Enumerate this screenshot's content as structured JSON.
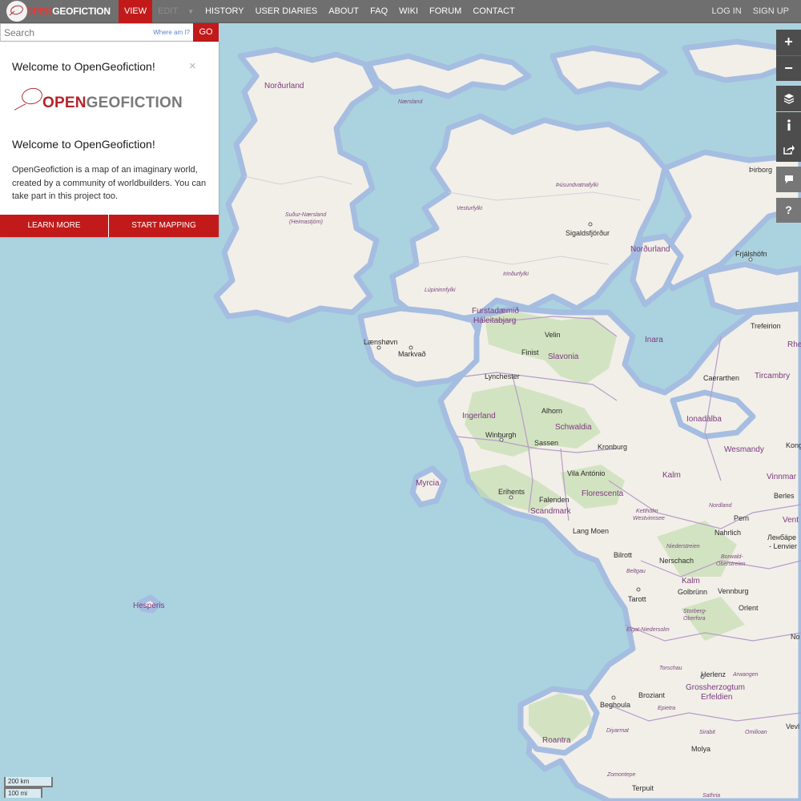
{
  "topbar": {
    "logo_part1": "OPEN",
    "logo_part2": "GEOFICTION",
    "nav": [
      {
        "label": "VIEW",
        "state": "active"
      },
      {
        "label": "EDIT",
        "state": "disabled"
      },
      {
        "label": "HISTORY"
      },
      {
        "label": "USER DIARIES"
      },
      {
        "label": "ABOUT"
      },
      {
        "label": "FAQ"
      },
      {
        "label": "WIKI"
      },
      {
        "label": "FORUM"
      },
      {
        "label": "CONTACT"
      }
    ],
    "login": "LOG IN",
    "signup": "SIGN UP"
  },
  "search": {
    "placeholder": "Search",
    "where_am_i": "Where am I?",
    "go": "GO"
  },
  "welcome": {
    "heading": "Welcome to OpenGeofiction!",
    "close_glyph": "×",
    "logo_a": "OPEN",
    "logo_b": "GEOFICTION",
    "heading2": "Welcome to OpenGeofiction!",
    "body": "OpenGeofiction is a map of an imaginary world, created by a community of worldbuilders. You can take part in this project too.",
    "learn_more": "LEARN MORE",
    "start_mapping": "START MAPPING"
  },
  "controls": {
    "zoom_in": "+",
    "zoom_out": "−",
    "layers_icon": "layers-icon",
    "info_icon": "info-icon",
    "share_icon": "share-icon",
    "note_icon": "note-icon",
    "query": "?"
  },
  "scale": {
    "km": "200 km",
    "mi": "100 mi"
  },
  "map_labels": {
    "nordurland_w": "Norðurland",
    "naersland": "Nærsland",
    "sudur": "Suður-Nærsland",
    "heimastjorn": "(Heimastjórn)",
    "thusund": "Þúsundvatnafylki",
    "vesturfylki": "Vesturfylki",
    "sigalds": "Sigaldsfjörður",
    "nordurland_e": "Norðurland",
    "thirborg": "Þirborg",
    "frjalshofn": "Frjálshöfn",
    "irindur": "Irinðurfylki",
    "lupinin": "Lúpininnfylki",
    "furstadaemid": "Furstadæmið",
    "haleitabjarg": "Háleitabjarg",
    "laenshovn": "Lænshøvn",
    "markvad": "Markvað",
    "velin": "Velin",
    "finist": "Finist",
    "slavonia": "Slavonia",
    "inara": "Inara",
    "trefeirion": "Trefeirion",
    "rhe": "Rhe",
    "lynchester": "Lynchester",
    "caerarthen": "Caerarthen",
    "tircambry": "Tircambry",
    "ingerland": "Ingerland",
    "alhorn": "Alhorn",
    "schwaldia": "Schwaldia",
    "ionadalba": "Ionadàlba",
    "winburgh": "Winburgh",
    "sassen": "Sassen",
    "kronburg": "Kronburg",
    "wesmandy": "Wesmandy",
    "kong": "Kong",
    "vila_antonio": "Vila António",
    "kalm1": "Kalm",
    "vinnmark": "Vinnmar",
    "myrcia": "Myrcia",
    "erihents": "Erihents",
    "falenden": "Falenden",
    "florescenta": "Florescenta",
    "berles": "Berles",
    "ketholm": "Ketthölm",
    "westvinnsee": "Westvinnsee",
    "nordland": "Nordland",
    "scandmark": "Scandmark",
    "pern": "Pern",
    "vent": "Vent",
    "lang_moen": "Lang Moen",
    "nahrlich": "Nahrlich",
    "lenbape": "Ленбäpe",
    "lenvier": "- Lenvier",
    "niederstreien": "Niederstreien",
    "bilrott": "Bilrott",
    "borwald": "Borwald-",
    "oberstreien": "Oberstreien",
    "nerschach": "Nerschach",
    "beltgau": "Beltgau",
    "kalm2": "Kalm",
    "golbrunn": "Golbrünn",
    "vennburg": "Vennburg",
    "tarott": "Tarott",
    "orlent": "Orlent",
    "storberg": "Storberg-",
    "oberfora": "Oberfora",
    "hesperis": "Hesperis",
    "elgat": "Elgat-Niedersolm",
    "no": "No",
    "torschau": "Torschau",
    "herlenz": "Herlenz",
    "arwangen": "Arwangen",
    "grossherzog": "Grossherzogtum",
    "erfeldien": "Erfeldien",
    "broziant": "Broziant",
    "beghoula": "Beghoula",
    "epietra": "Epietra",
    "diyarmat": "Diyarmat",
    "sirabit": "Sirabit",
    "omilioan": "Omilioan",
    "vevl": "Vevl",
    "roantra": "Roantra",
    "molya": "Molya",
    "zomontepe": "Zomontepe",
    "terpuit": "Terpuit",
    "sathria": "Sathria"
  }
}
